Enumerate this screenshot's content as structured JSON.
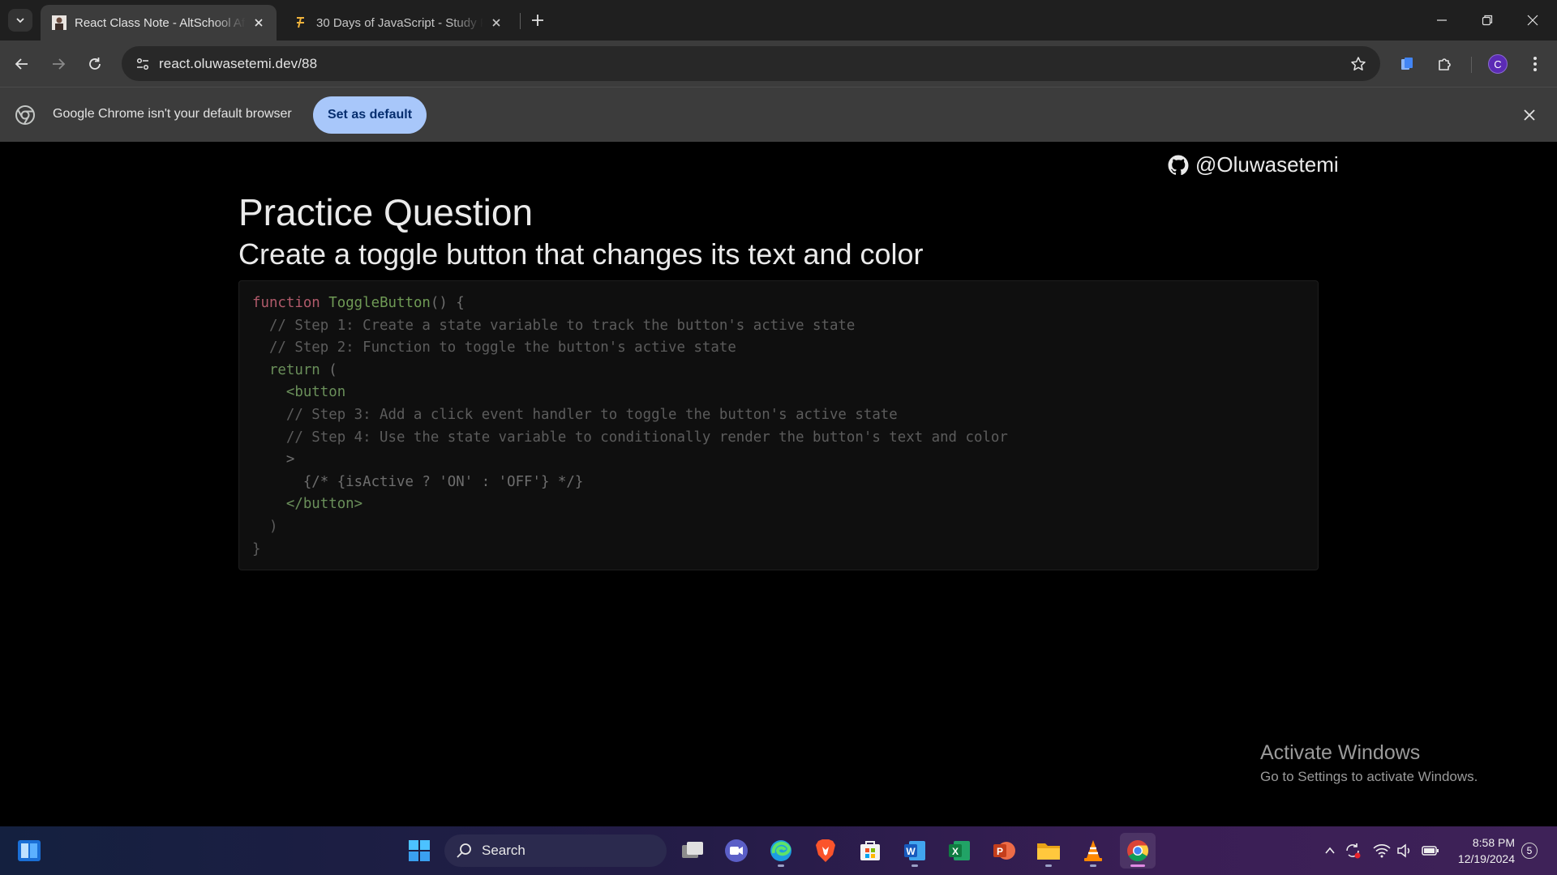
{
  "browser": {
    "tabs": [
      {
        "title": "React Class Note - AltSchool Af",
        "favicon": "avatar-favicon",
        "active": true
      },
      {
        "title": "30 Days of JavaScript - Study Pl",
        "favicon": "js-favicon",
        "active": false
      }
    ],
    "url": "react.oluwasetemi.dev/88",
    "profile_initial": "C"
  },
  "infobar": {
    "message": "Google Chrome isn't your default browser",
    "button": "Set as default"
  },
  "page": {
    "github_handle": "@Oluwasetemi",
    "heading": "Practice Question",
    "subheading": "Create a toggle button that changes its text and color",
    "code": {
      "l1_kw": "function",
      "l1_fn": "ToggleButton",
      "l1_rest": "() {",
      "l2": "  // Step 1: Create a state variable to track the button's active state",
      "l3": "  // Step 2: Function to toggle the button's active state",
      "l4_kw": "  return",
      "l4_rest": " (",
      "l5_tag": "    <button",
      "l6": "    // Step 3: Add a click event handler to toggle the button's active state",
      "l7": "    // Step 4: Use the state variable to conditionally render the button's text and color",
      "l8": "    >",
      "l9": "      {/* {isActive ? 'ON' : 'OFF'} */}",
      "l10_tag": "    </button>",
      "l11": "  )",
      "l12": "}"
    },
    "watermark_title": "Activate Windows",
    "watermark_sub": "Go to Settings to activate Windows."
  },
  "taskbar": {
    "search_label": "Search",
    "time": "8:58 PM",
    "date": "12/19/2024",
    "notification_count": "5",
    "colors": {
      "accent": "#e089e3"
    }
  }
}
